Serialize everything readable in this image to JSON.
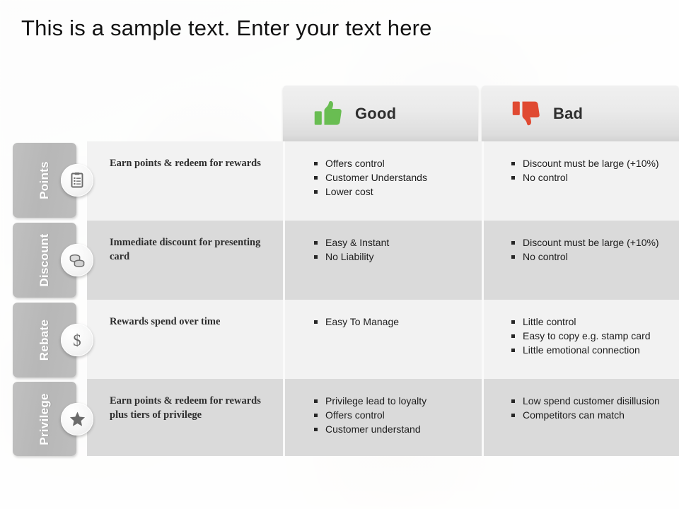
{
  "slide": {
    "title": "This is a sample text. Enter your text here",
    "background_color": "#fbfbfa"
  },
  "header": {
    "columns": [
      {
        "label": "Good",
        "icon": "thumbs-up-icon",
        "icon_color": "#69bd52"
      },
      {
        "label": "Bad",
        "icon": "thumbs-down-icon",
        "icon_color": "#e04a32"
      }
    ]
  },
  "table": {
    "row_colors": {
      "odd": "#f2f2f2",
      "even": "#dadada"
    },
    "tab_color": "#bababa",
    "rows": [
      {
        "category": "Points",
        "icon": "clipboard-list-icon",
        "description": "Earn points  & redeem for rewards",
        "good": [
          "Offers control",
          "Customer Understands",
          "Lower cost"
        ],
        "bad": [
          "Discount must be large (+10%)",
          "No control"
        ]
      },
      {
        "category": "Discount",
        "icon": "coins-icon",
        "description": "Immediate  discount for presenting  card",
        "good": [
          "Easy & Instant",
          "No Liability"
        ],
        "bad": [
          "Discount  must be large (+10%)",
          "No control"
        ]
      },
      {
        "category": "Rebate",
        "icon": "dollar-sign-icon",
        "description": "Rewards spend over time",
        "good": [
          "Easy To Manage"
        ],
        "bad": [
          "Little control",
          "Easy to copy e.g. stamp card",
          "Little emotional connection"
        ]
      },
      {
        "category": "Privilege",
        "icon": "star-icon",
        "description": "Earn points  & redeem for rewards plus  tiers of privilege",
        "good": [
          "Privilege lead to loyalty",
          "Offers control",
          "Customer understand"
        ],
        "bad": [
          "Low spend customer disillusion",
          "Competitors can match"
        ]
      }
    ]
  }
}
